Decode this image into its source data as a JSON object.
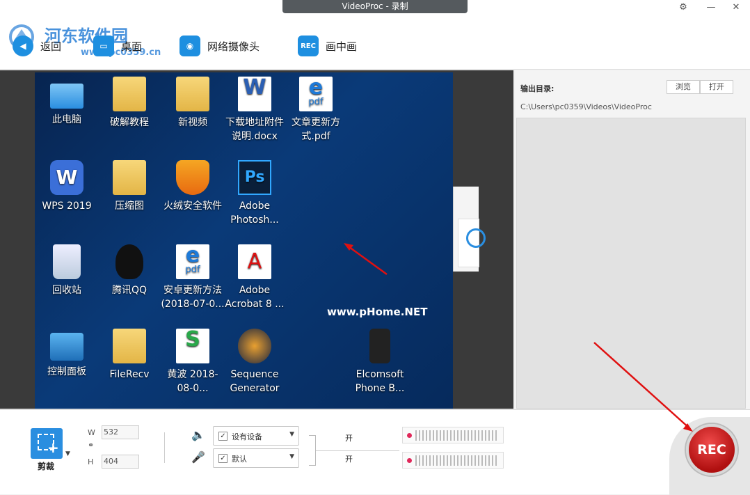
{
  "window": {
    "title": "VideoProc - 录制"
  },
  "watermark": {
    "text": "河东软件园",
    "url": "www.pc0359.cn",
    "phome": "www.pHome.NET"
  },
  "toolbar": {
    "back_label": "返回",
    "desktop_label": "桌面",
    "webcam_label": "网络摄像头",
    "pip_label": "画中画",
    "pip_icon_text": "REC"
  },
  "desktop_icons": [
    {
      "label": "此电脑",
      "icon": "computer-icon"
    },
    {
      "label": "破解教程",
      "icon": "folder-icon"
    },
    {
      "label": "新视频",
      "icon": "folder-icon"
    },
    {
      "label": "下载地址附件说明.docx",
      "icon": "docx-icon"
    },
    {
      "label": "文章更新方式.pdf",
      "icon": "pdf-icon"
    },
    {
      "label": "WPS 2019",
      "icon": "wps-icon"
    },
    {
      "label": "压缩图",
      "icon": "folder-icon"
    },
    {
      "label": "火绒安全软件",
      "icon": "shield-icon"
    },
    {
      "label": "Adobe Photosh...",
      "icon": "photoshop-icon"
    },
    {
      "label": "回收站",
      "icon": "recycle-bin-icon"
    },
    {
      "label": "腾讯QQ",
      "icon": "qq-icon"
    },
    {
      "label": "安卓更新方法(2018-07-0...",
      "icon": "pdf-icon"
    },
    {
      "label": "Adobe Acrobat 8 ...",
      "icon": "acrobat-icon"
    },
    {
      "label": "控制面板",
      "icon": "control-panel-icon"
    },
    {
      "label": "FileRecv",
      "icon": "folder-icon"
    },
    {
      "label": "黄波 2018-08-0...",
      "icon": "spreadsheet-icon"
    },
    {
      "label": "Sequence Generator",
      "icon": "sequence-icon"
    },
    {
      "label": "Elcomsoft Phone B...",
      "icon": "phone-icon"
    }
  ],
  "output": {
    "label": "输出目录:",
    "browse_label": "浏览",
    "open_label": "打开",
    "path": "C:\\Users\\pc0359\\Videos\\VideoProc"
  },
  "crop": {
    "label": "剪裁",
    "w_label": "W",
    "h_label": "H",
    "width": "532",
    "height": "404"
  },
  "audio": {
    "speaker_device": "设有设备",
    "mic_device": "默认",
    "speaker_state": "开",
    "mic_state": "开"
  },
  "rec": {
    "label": "REC"
  },
  "colors": {
    "accent": "#1e8fe0",
    "rec": "#d01818",
    "arrow": "#e01010"
  }
}
